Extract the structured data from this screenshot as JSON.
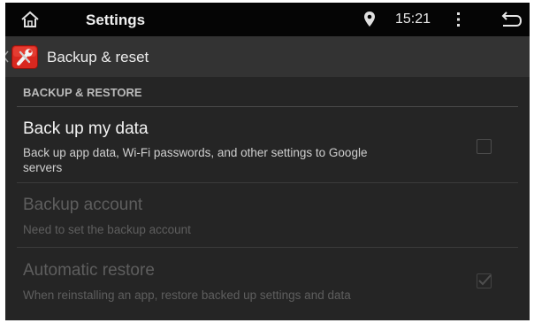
{
  "status_bar": {
    "title": "Settings",
    "time": "15:21",
    "home_icon": "home-icon",
    "location_icon": "location-pin-icon",
    "overflow_icon": "overflow-menu-icon",
    "back_icon": "back-arrow-icon"
  },
  "action_bar": {
    "title": "Backup & reset",
    "app_icon": "settings-wrench-icon"
  },
  "section": {
    "header": "BACKUP & RESTORE"
  },
  "preferences": [
    {
      "title": "Back up my data",
      "summary_line1": "Back up app data, Wi-Fi passwords, and other settings to Google",
      "summary_line2": "servers",
      "enabled": true,
      "checked": false
    },
    {
      "title": "Backup account",
      "summary": "Need to set the backup account",
      "enabled": false
    },
    {
      "title": "Automatic restore",
      "summary": "When reinstalling an app, restore backed up settings and data",
      "enabled": false,
      "checked": true
    }
  ],
  "colors": {
    "background": "#252525",
    "status_bar": "#050505",
    "action_bar": "#333333",
    "enabled_text": "#f2f2f2",
    "disabled_text": "#5e5e5e",
    "app_icon_red": "#d8281f"
  }
}
